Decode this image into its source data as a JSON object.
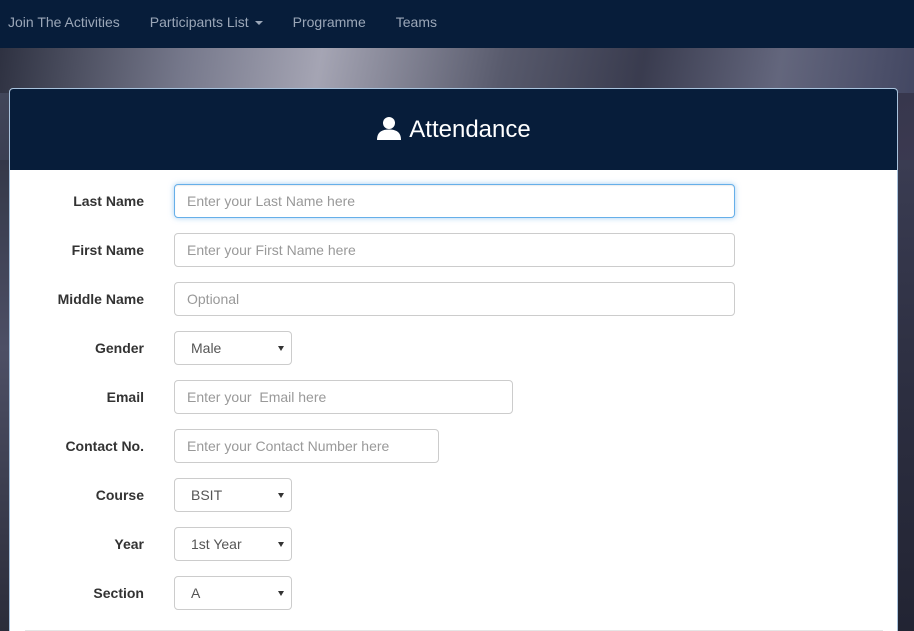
{
  "navbar": {
    "items": [
      {
        "label": "Join The Activities"
      },
      {
        "label": "Participants List",
        "has_dropdown": true
      },
      {
        "label": "Programme"
      },
      {
        "label": "Teams"
      }
    ]
  },
  "panel": {
    "title": "Attendance",
    "title_icon": "user-icon"
  },
  "form": {
    "last_name": {
      "label": "Last Name",
      "placeholder": "Enter your Last Name here",
      "value": ""
    },
    "first_name": {
      "label": "First Name",
      "placeholder": "Enter your First Name here",
      "value": ""
    },
    "middle_name": {
      "label": "Middle Name",
      "placeholder": "Optional",
      "value": ""
    },
    "gender": {
      "label": "Gender",
      "selected": "Male"
    },
    "email": {
      "label": "Email",
      "placeholder": "Enter your  Email here",
      "value": ""
    },
    "contact": {
      "label": "Contact No.",
      "placeholder": "Enter your Contact Number here",
      "value": ""
    },
    "course": {
      "label": "Course",
      "selected": "BSIT"
    },
    "year": {
      "label": "Year",
      "selected": "1st Year"
    },
    "section": {
      "label": "Section",
      "selected": "A"
    }
  },
  "colors": {
    "navbar_bg": "#071d3a",
    "panel_heading_bg": "#071d3a",
    "focus_border": "#66afe9"
  }
}
